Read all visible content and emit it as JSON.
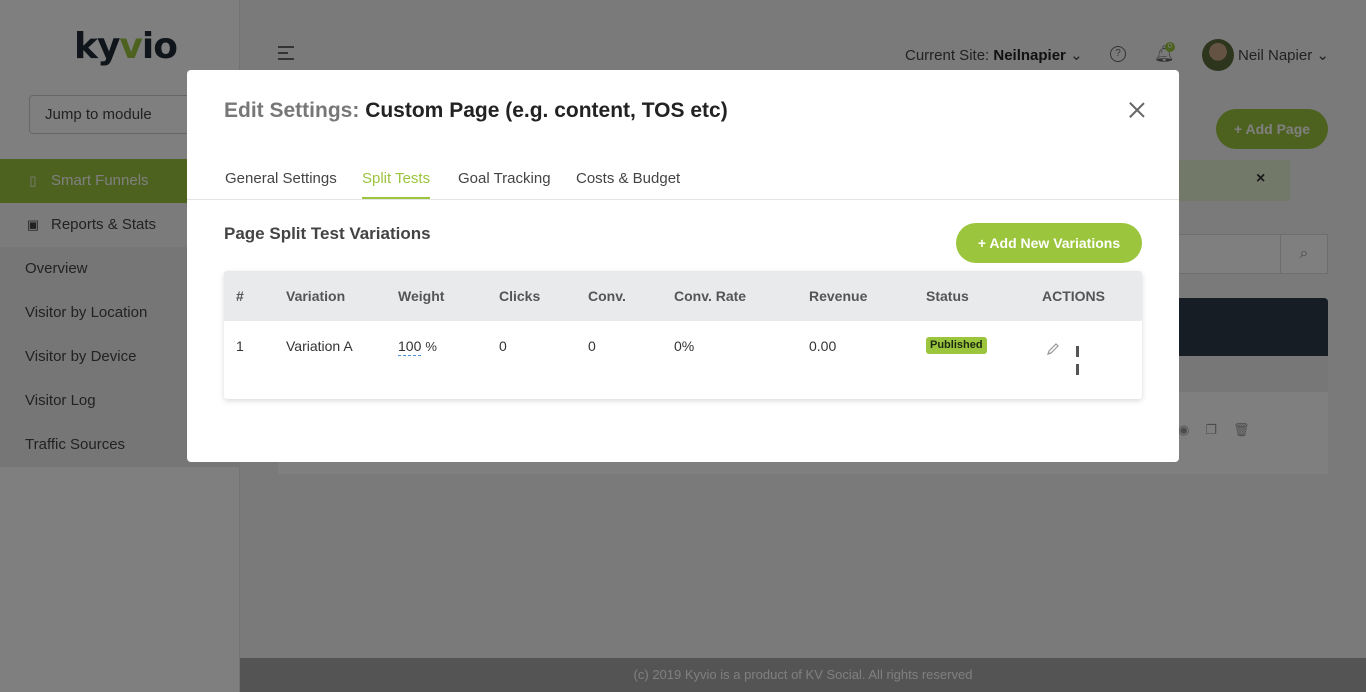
{
  "app": {
    "logo": {
      "text_a": "ky",
      "text_v": "v",
      "text_b": "io"
    },
    "jump_to_module": "Jump to module",
    "sidebar": {
      "items": [
        {
          "label": "Smart Funnels",
          "icon": "map-icon"
        },
        {
          "label": "Reports & Stats",
          "icon": "spreadsheet-icon"
        }
      ],
      "submenu": [
        "Overview",
        "Visitor by Location",
        "Visitor by Device",
        "Visitor Log",
        "Traffic Sources"
      ]
    },
    "header": {
      "current_site_label": "Current Site:",
      "current_site_value": "Neilnapier",
      "notification_count": "0",
      "user_name": "Neil Napier"
    },
    "add_page_button": "+ Add Page",
    "alert_close": "×",
    "footer": "(c) 2019 Kyvio is a product of KV Social. All rights reserved"
  },
  "modal": {
    "title_prefix": "Edit Settings:",
    "title_main": "Custom Page (e.g. content, TOS etc)",
    "tabs": [
      "General Settings",
      "Split Tests",
      "Goal Tracking",
      "Costs & Budget"
    ],
    "active_tab": "Split Tests",
    "section_title": "Page Split Test Variations",
    "add_variations_button": "+ Add New Variations",
    "table": {
      "headers": [
        "#",
        "Variation",
        "Weight",
        "Clicks",
        "Conv.",
        "Conv. Rate",
        "Revenue",
        "Status",
        "ACTIONS"
      ],
      "rows": [
        {
          "num": "1",
          "variation": "Variation A",
          "weight": "100",
          "weight_unit": "%",
          "clicks": "0",
          "conv": "0",
          "conv_rate": "0%",
          "revenue": "0.00",
          "status": "Published"
        }
      ]
    }
  },
  "colors": {
    "accent": "#9bc53d",
    "dark": "#2f3a48",
    "overlay": "rgba(0,0,0,0.5)"
  }
}
